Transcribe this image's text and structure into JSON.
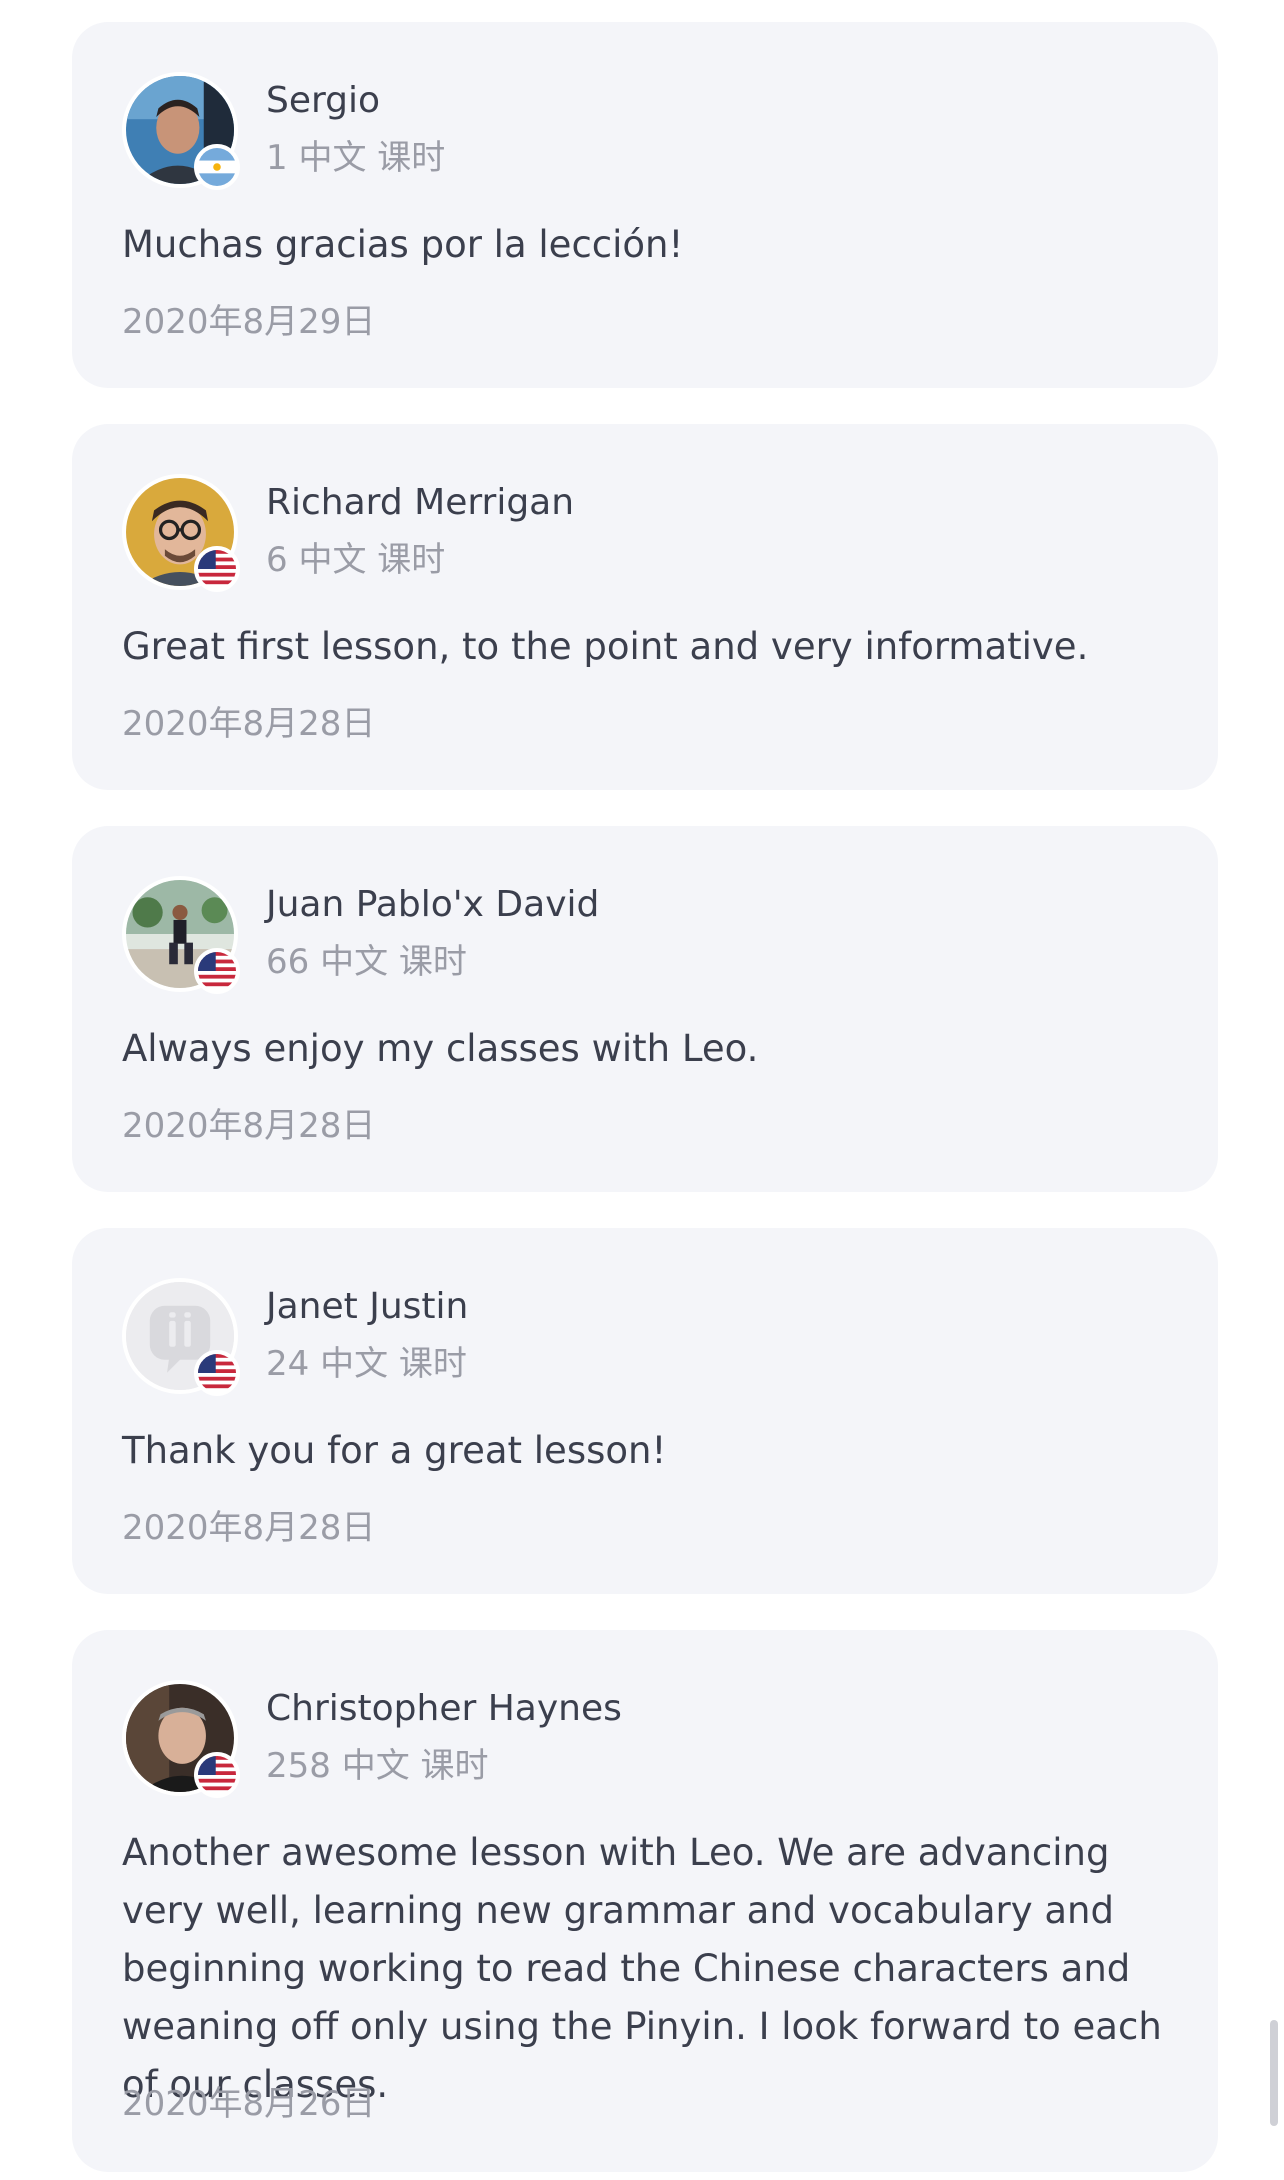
{
  "reviews": [
    {
      "name": "Sergio",
      "lessons": "1 中文 课时",
      "text": "Muchas gracias por la lección!",
      "date": "2020年8月29日",
      "avatar_icon": "photo-avatar",
      "flag": "argentina-flag-icon"
    },
    {
      "name": "Richard Merrigan",
      "lessons": "6 中文 课时",
      "text": "Great first lesson, to the point and very informative.",
      "date": "2020年8月28日",
      "avatar_icon": "photo-avatar",
      "flag": "us-flag-icon"
    },
    {
      "name": "Juan Pablo'x David",
      "lessons": "66 中文 课时",
      "text": "Always enjoy my classes with Leo.",
      "date": "2020年8月28日",
      "avatar_icon": "photo-avatar",
      "flag": "us-flag-icon"
    },
    {
      "name": "Janet Justin",
      "lessons": "24 中文 课时",
      "text": "Thank you for a great lesson!",
      "date": "2020年8月28日",
      "avatar_icon": "default-avatar-icon",
      "flag": "us-flag-icon"
    },
    {
      "name": "Christopher Haynes",
      "lessons": "258 中文 课时",
      "text": "Another awesome lesson with Leo. We are advancing very well, learning new grammar and vocabulary and beginning working to read the Chinese characters and weaning off only using the Pinyin. I look forward to each of our classes.",
      "date": "2020年8月26日",
      "avatar_icon": "photo-avatar",
      "flag": "us-flag-icon"
    }
  ],
  "colors": {
    "card_background": "#f4f5f9",
    "name_text": "#3b3f4d",
    "muted_text": "#9a9ca6"
  }
}
